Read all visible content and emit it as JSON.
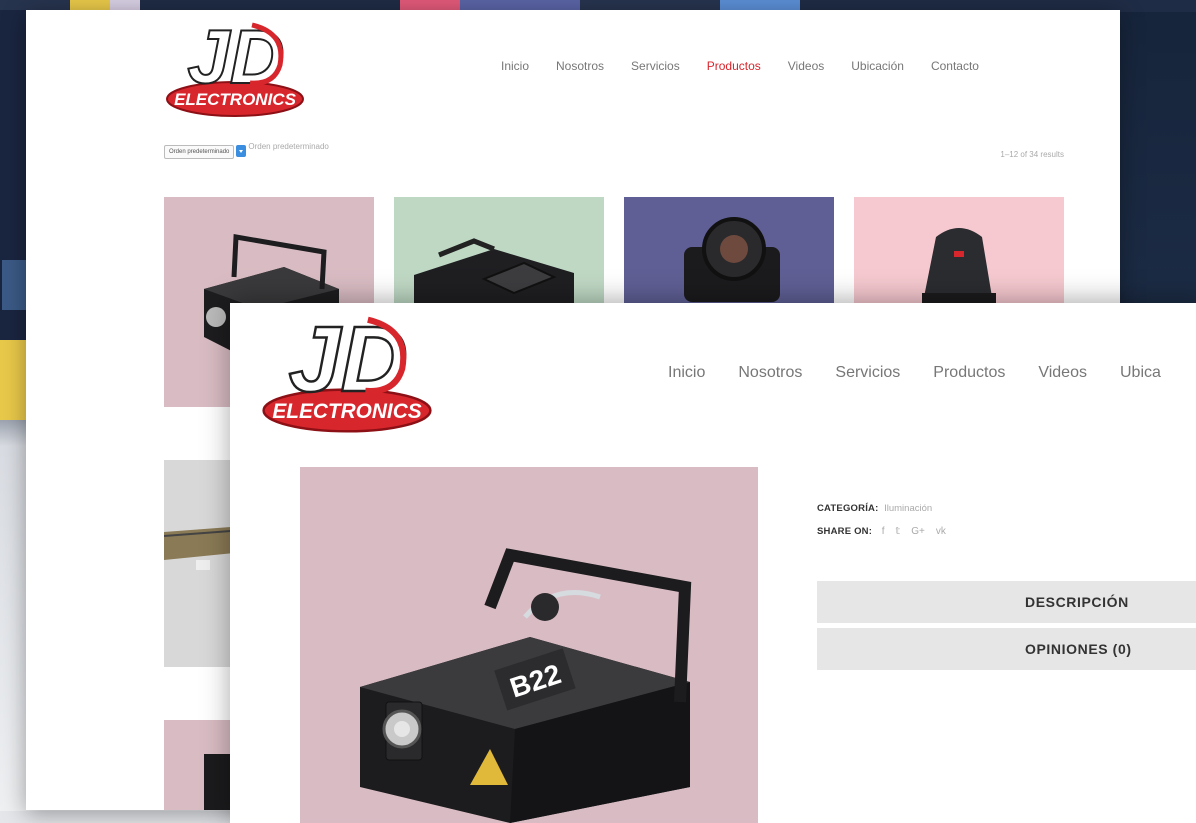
{
  "brand": {
    "logo_letters": "JD",
    "logo_text": "ELECTRONICS",
    "accent": "#d8262d"
  },
  "listing_page": {
    "nav": [
      {
        "label": "Inicio",
        "active": false
      },
      {
        "label": "Nosotros",
        "active": false
      },
      {
        "label": "Servicios",
        "active": false
      },
      {
        "label": "Productos",
        "active": true
      },
      {
        "label": "Videos",
        "active": false
      },
      {
        "label": "Ubicación",
        "active": false
      },
      {
        "label": "Contacto",
        "active": false
      }
    ],
    "sort": {
      "selected": "Orden predeterminado",
      "label": "Orden predeterminado"
    },
    "results": "1–12 of 34 results",
    "tile_colors": [
      "#d9bcc3",
      "#bfd8c4",
      "#5f5f95",
      "#f5c9cf",
      "#d8d8d8",
      "#e7e7e7",
      "#d9bcc3"
    ]
  },
  "product_page": {
    "nav": [
      {
        "label": "Inicio"
      },
      {
        "label": "Nosotros"
      },
      {
        "label": "Servicios"
      },
      {
        "label": "Productos"
      },
      {
        "label": "Videos"
      },
      {
        "label": "Ubica"
      }
    ],
    "category_label": "CATEGORÍA:",
    "category_value": "Iluminación",
    "share_label": "SHARE ON:",
    "share_icons": [
      "f",
      "𝕥",
      "G+",
      "vk"
    ],
    "tabs": {
      "description": "DESCRIPCIÓN",
      "reviews": "OPINIONES (0)"
    },
    "image_bg": "#d9bcc3"
  }
}
